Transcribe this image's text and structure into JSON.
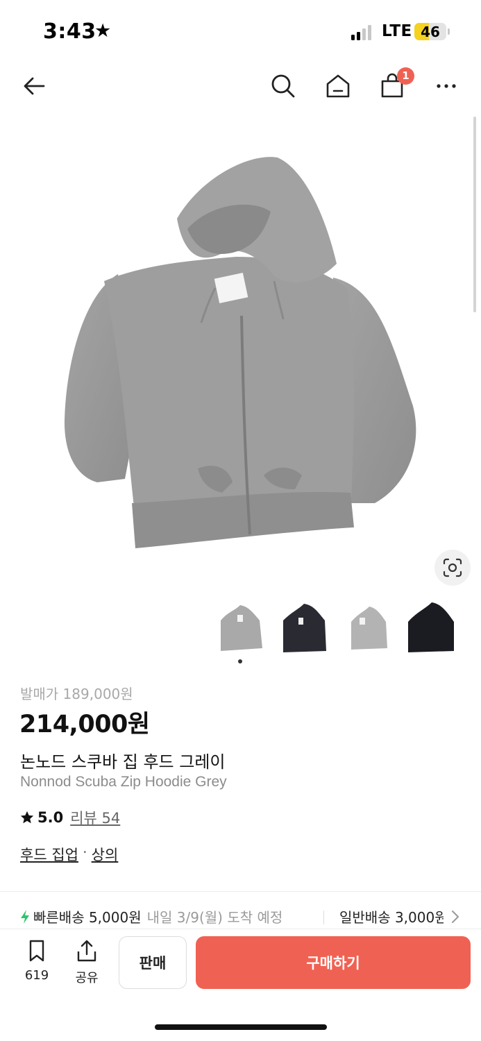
{
  "status_bar": {
    "time": "3:43",
    "star": "★",
    "network": "LTE",
    "battery": "46",
    "battery_level": 0.46
  },
  "header": {
    "back_icon": "arrow-left-icon",
    "search_icon": "search-icon",
    "home_icon": "home-icon",
    "cart_icon": "shopping-bag-icon",
    "cart_count": "1",
    "more_icon": "more-horizontal-icon"
  },
  "product": {
    "image_color": "grey hoodie",
    "thumbnails": [
      {
        "name": "grey-hoodie-front",
        "color": "#a9a9a9"
      },
      {
        "name": "black-hoodie-front",
        "color": "#2a2a33"
      },
      {
        "name": "grey-hoodie-alt",
        "color": "#b3b3b3"
      },
      {
        "name": "black-hoodie-alt",
        "color": "#1b1c22"
      }
    ],
    "original_price": "발매가 189,000원",
    "price": "214,000원",
    "name_ko": "논노드 스쿠바 집 후드 그레이",
    "name_en": "Nonnod Scuba Zip Hoodie Grey",
    "rating": "5.0",
    "rating_value": 5.0,
    "review_label": "리뷰 54",
    "category_1": "후드 집업",
    "category_sep": "·",
    "category_2": "상의"
  },
  "shipping": {
    "fast_label": "빠른배송 5,000원",
    "fast_eta": "내일 3/9(월) 도착 예정",
    "normal_label": "일반배송 3,000원"
  },
  "bottom_bar": {
    "bookmark_count": "619",
    "share_label": "공유",
    "sell_label": "판매",
    "buy_label": "구매하기"
  },
  "colors": {
    "accent": "#ef6253",
    "fast_shipping_bolt": "#2ec46b"
  }
}
